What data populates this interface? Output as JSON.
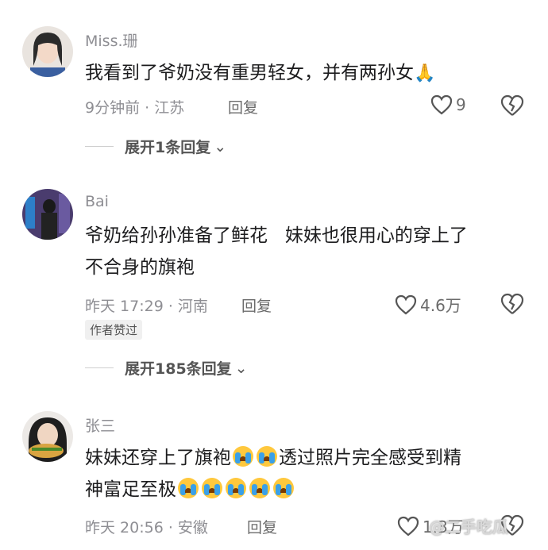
{
  "comments": [
    {
      "username": "Miss.珊",
      "text": "我看到了爷奶没有重男轻女，并有两孙女",
      "emoji": "🙏",
      "time_location": "9分钟前 · 江苏",
      "reply_label": "回复",
      "likes": "9",
      "expand_label": "展开1条回复"
    },
    {
      "username": "Bai",
      "text_line1": "爷奶给孙孙准备了鲜花   妹妹也很用心的穿上了",
      "text_line2": "不合身的旗袍",
      "time_location": "昨天 17:29 · 河南",
      "reply_label": "回复",
      "likes": "4.6万",
      "badge": "作者赞过",
      "expand_label": "展开185条回复"
    },
    {
      "username": "张三",
      "text_line1_a": "妹妹还穿上了旗袍",
      "text_line1_b": "透过照片完全感受到精",
      "text_line2": "神富足至极",
      "time_location": "昨天 20:56 · 安徽",
      "reply_label": "回复",
      "likes": "1.3万"
    }
  ],
  "watermark": "@二手吃瓜",
  "colors": {
    "text": "#1c1c1e",
    "meta": "#8e8e93",
    "background": "#ffffff"
  }
}
